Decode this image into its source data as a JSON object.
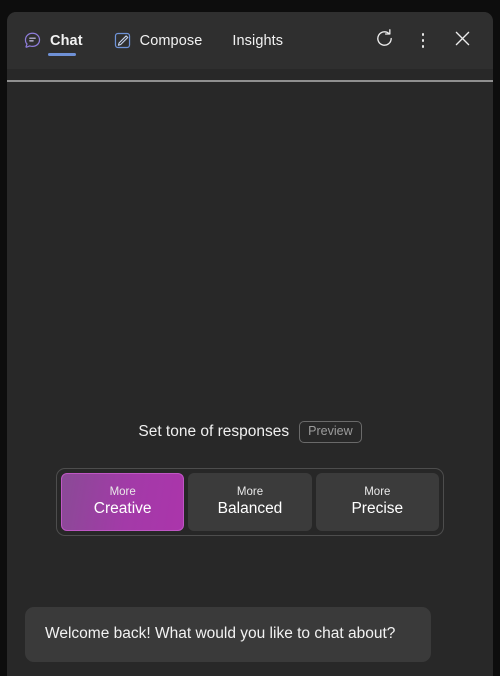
{
  "theme": {
    "outer_background": "#0d0d0d",
    "panel_background": "#282828",
    "header_background": "#2f2f2f",
    "accent_tab_underline": "#6f91d6",
    "accent_selected_tone_start": "#8a4a96",
    "accent_selected_tone_end": "#ab35ab",
    "bubble_background": "#3a3a3a",
    "unselected_tone_background": "#3b3b3b"
  },
  "header": {
    "tabs": [
      {
        "label": "Chat",
        "icon": "chat-bubble-icon",
        "active": true
      },
      {
        "label": "Compose",
        "icon": "compose-pencil-icon",
        "active": false
      },
      {
        "label": "Insights",
        "icon": "none",
        "active": false
      }
    ],
    "actions": [
      {
        "name": "refresh-button",
        "icon": "refresh-icon"
      },
      {
        "name": "more-options-button",
        "icon": "kebab-menu-icon"
      },
      {
        "name": "close-button",
        "icon": "close-icon"
      }
    ]
  },
  "tone": {
    "title": "Set tone of responses",
    "preview_badge": "Preview",
    "options": [
      {
        "sub": "More",
        "main": "Creative",
        "selected": true
      },
      {
        "sub": "More",
        "main": "Balanced",
        "selected": false
      },
      {
        "sub": "More",
        "main": "Precise",
        "selected": false
      }
    ]
  },
  "conversation": {
    "messages": [
      {
        "author": "assistant",
        "text": "Welcome back! What would you like to chat about?"
      }
    ]
  }
}
